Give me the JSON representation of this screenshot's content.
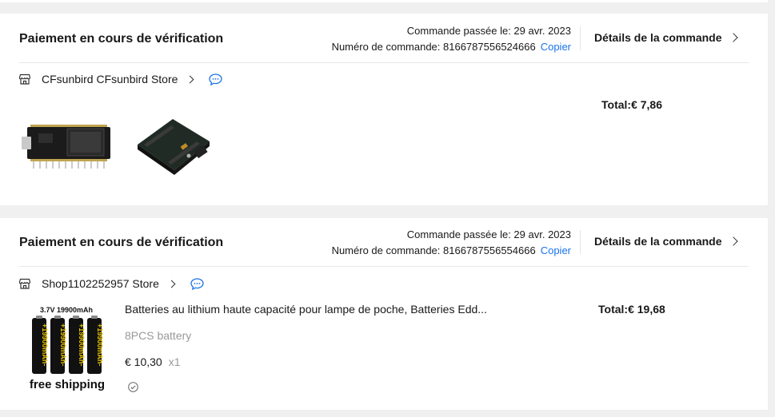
{
  "orders": [
    {
      "status": "Paiement en cours de vérification",
      "date_line": "Commande passée le: 29 avr. 2023",
      "number_line": "Numéro de commande: 8166787556524666",
      "copy_label": "Copier",
      "details_label": "Détails de la commande",
      "store_name": "CFsunbird CFsunbird Store",
      "total": "Total:€ 7,86",
      "thumbnails": [
        "esp32-dev-board",
        "esp32-expansion-board"
      ]
    },
    {
      "status": "Paiement en cours de vérification",
      "date_line": "Commande passée le: 29 avr. 2023",
      "number_line": "Numéro de commande: 8166787556554666",
      "copy_label": "Copier",
      "details_label": "Détails de la commande",
      "store_name": "Shop1102252957 Store",
      "total": "Total:€ 19,68",
      "item": {
        "title": "Batteries au lithium haute capacité pour lampe de poche, Batteries Edd...",
        "variant": "8PCS battery",
        "price": "€ 10,30",
        "qty": "x1",
        "image_caption_top": "3.7V 19900mAh",
        "image_caption_bottom": "free shipping",
        "battery_label": "+19900mAh-"
      }
    }
  ],
  "icons": {
    "store": "store-icon",
    "message": "chat-bubble-icon",
    "chevron": "chevron-right-icon",
    "protection": "shield-check-icon"
  },
  "colors": {
    "link": "#1a73e8",
    "muted": "#999999",
    "background": "#f0f0f0"
  }
}
